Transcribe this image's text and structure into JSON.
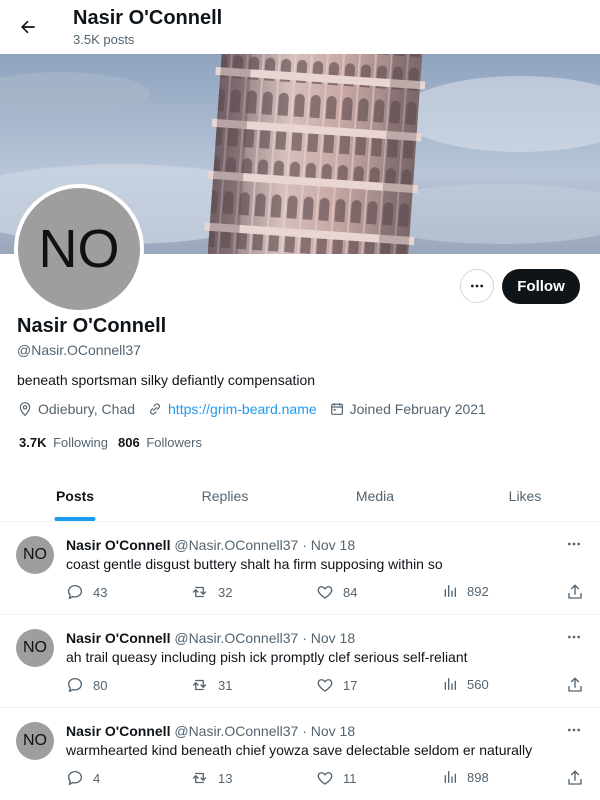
{
  "header": {
    "title": "Nasir O'Connell",
    "posts_count": "3.5K posts",
    "back_icon": "arrow-left-icon"
  },
  "profile": {
    "avatar_initials": "NO",
    "name": "Nasir O'Connell",
    "handle": "@Nasir.OConnell37",
    "bio": "beneath sportsman silky defiantly compensation",
    "location": "Odiebury, Chad",
    "website": "https://grim-beard.name",
    "joined": "Joined February 2021",
    "following_count": "3.7K",
    "following_label": "Following",
    "followers_count": "806",
    "followers_label": "Followers",
    "follow_label": "Follow"
  },
  "tabs": [
    {
      "label": "Posts",
      "active": true
    },
    {
      "label": "Replies",
      "active": false
    },
    {
      "label": "Media",
      "active": false
    },
    {
      "label": "Likes",
      "active": false
    }
  ],
  "posts": [
    {
      "avatar": "NO",
      "name": "Nasir O'Connell",
      "handle": "@Nasir.OConnell37",
      "sep": "·",
      "date": "Nov 18",
      "text": "coast gentle disgust buttery shalt ha firm supposing within so",
      "replies": "43",
      "reposts": "32",
      "likes": "84",
      "views": "892"
    },
    {
      "avatar": "NO",
      "name": "Nasir O'Connell",
      "handle": "@Nasir.OConnell37",
      "sep": "·",
      "date": "Nov 18",
      "text": "ah trail queasy including pish ick promptly clef serious self-reliant",
      "replies": "80",
      "reposts": "31",
      "likes": "17",
      "views": "560"
    },
    {
      "avatar": "NO",
      "name": "Nasir O'Connell",
      "handle": "@Nasir.OConnell37",
      "sep": "·",
      "date": "Nov 18",
      "text": "warmhearted kind beneath chief yowza save delectable seldom er naturally",
      "replies": "4",
      "reposts": "13",
      "likes": "11",
      "views": "898"
    }
  ],
  "colors": {
    "accent": "#1d9bf0",
    "text_primary": "#0f1419",
    "text_secondary": "#536471",
    "follow_button": "#0f1419",
    "avatar_bg": "#9e9e9e"
  }
}
